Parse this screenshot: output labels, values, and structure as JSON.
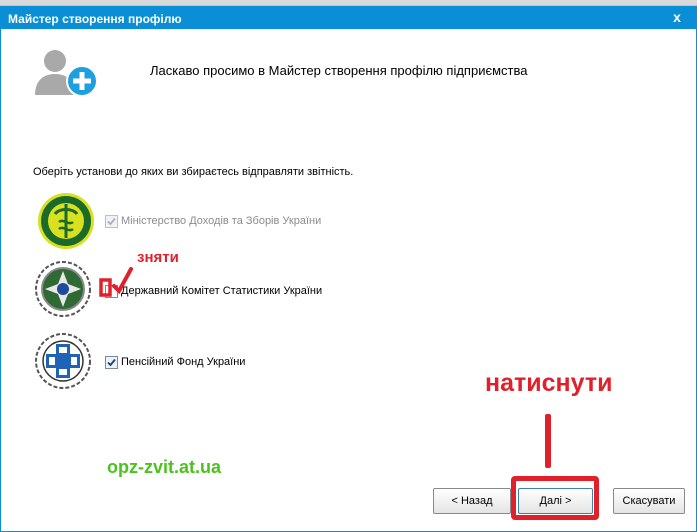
{
  "window": {
    "title": "Майстер створення профілю",
    "close_glyph": "x"
  },
  "header": {
    "icon": "user-add-icon",
    "welcome_text": "Ласкаво просимо в Майстер створення профілю підприємства"
  },
  "instruction": "Оберіть установи до яких ви збираєтесь відправляти звітність.",
  "organizations": [
    {
      "label": "Міністерство Доходів та Зборів України",
      "checked": true,
      "disabled": true,
      "icon": "ministry-revenue-logo"
    },
    {
      "label": "Державний Комітет Статистики України",
      "checked": false,
      "disabled": false,
      "icon": "state-statistics-logo"
    },
    {
      "label": "Пенсійний Фонд України",
      "checked": true,
      "disabled": false,
      "icon": "pension-fund-logo"
    }
  ],
  "annotations": {
    "uncheck_text": "зняти",
    "press_text": "натиснути",
    "site_text": "opz-zvit.at.ua",
    "color": "#e0202a",
    "site_color": "#4cc21e"
  },
  "buttons": {
    "back": "< Назад",
    "next": "Далі >",
    "cancel": "Скасувати"
  },
  "colors": {
    "titlebar": "#0a8fd6",
    "icon_plus": "#1e9fe0"
  }
}
